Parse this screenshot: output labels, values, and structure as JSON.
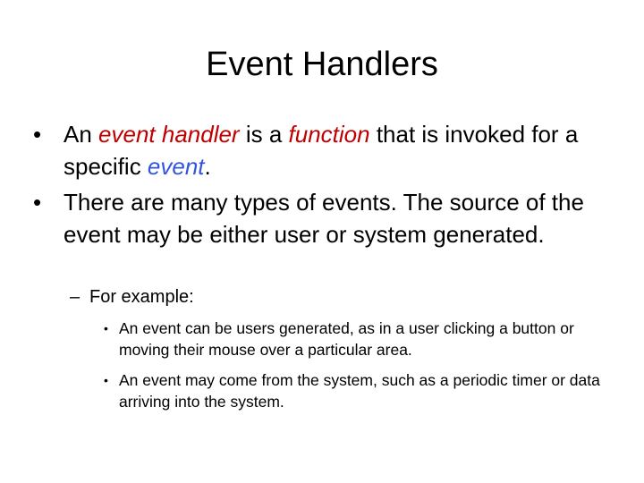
{
  "slide": {
    "title": "Event Handlers",
    "bullets": [
      {
        "mark": "•",
        "parts": [
          "An ",
          "event handler",
          " is a ",
          "function",
          " that is invoked for a specific ",
          "event",
          "."
        ]
      },
      {
        "mark": "•",
        "text": "There are many types of events. The source of the event may be either user or system generated."
      }
    ],
    "sub_bullet": {
      "mark": "–",
      "text": "For example:"
    },
    "sub_sub_bullets": [
      {
        "mark": "•",
        "text": "An event can be users generated, as in a user clicking a button or moving their mouse over a particular area."
      },
      {
        "mark": "•",
        "text": "An event may come from the system, such as a periodic timer or data arriving into the system."
      }
    ]
  }
}
